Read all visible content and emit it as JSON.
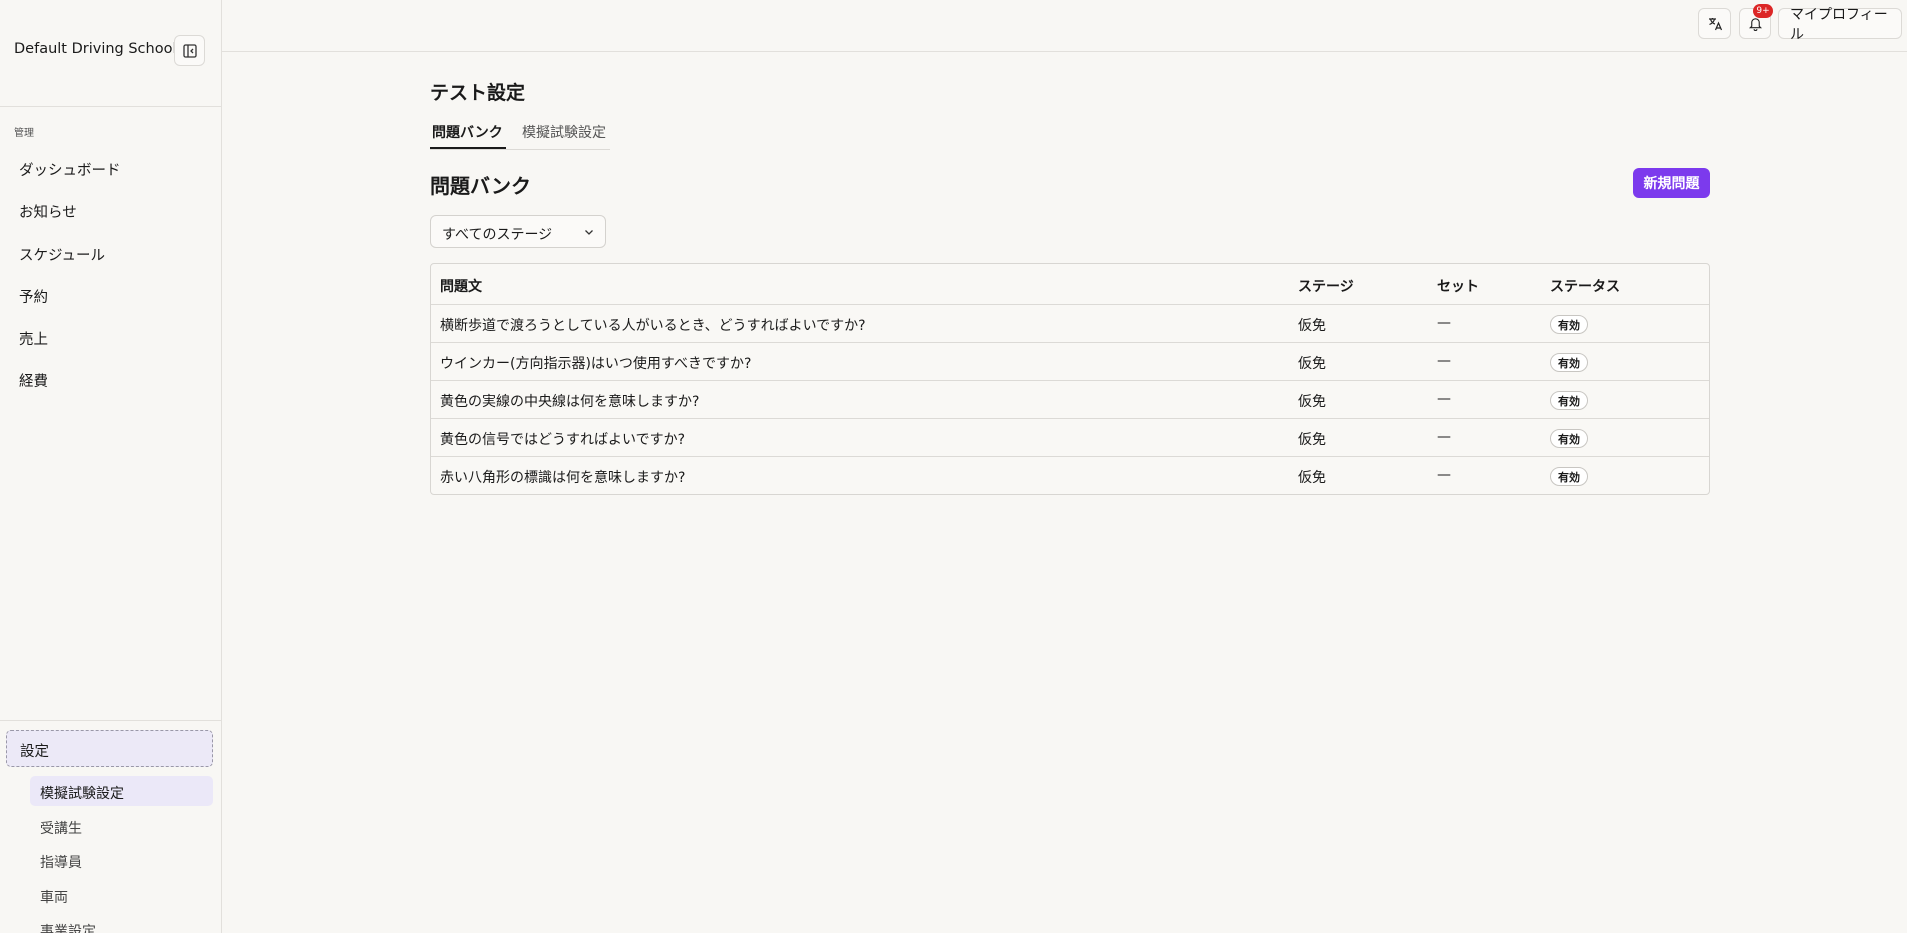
{
  "brand": {
    "name": "Default Driving School"
  },
  "sidebar": {
    "section_label": "管理",
    "items": [
      {
        "label": "ダッシュボード"
      },
      {
        "label": "お知らせ"
      },
      {
        "label": "スケジュール"
      },
      {
        "label": "予約"
      },
      {
        "label": "売上"
      },
      {
        "label": "経費"
      }
    ],
    "settings_label": "設定",
    "sub_items": [
      {
        "label": "模擬試験設定",
        "active": true
      },
      {
        "label": "受講生"
      },
      {
        "label": "指導員"
      },
      {
        "label": "車両"
      },
      {
        "label": "事業設定"
      }
    ]
  },
  "header": {
    "notification_badge": "9+",
    "profile_label": "マイプロフィール",
    "icons": [
      "translate-icon",
      "bell-icon"
    ]
  },
  "main": {
    "page_title": "テスト設定",
    "tabs": [
      {
        "label": "問題バンク",
        "active": true
      },
      {
        "label": "模擬試験設定"
      }
    ],
    "section_title": "問題バンク",
    "new_button_label": "新規問題",
    "stage_filter_value": "すべてのステージ",
    "table": {
      "columns": [
        "問題文",
        "ステージ",
        "セット",
        "ステータス"
      ],
      "rows": [
        {
          "question": "横断歩道で渡ろうとしている人がいるとき、どうすればよいですか?",
          "stage": "仮免",
          "set": "—",
          "status": "有効"
        },
        {
          "question": "ウインカー(方向指示器)はいつ使用すべきですか?",
          "stage": "仮免",
          "set": "—",
          "status": "有効"
        },
        {
          "question": "黄色の実線の中央線は何を意味しますか?",
          "stage": "仮免",
          "set": "—",
          "status": "有効"
        },
        {
          "question": "黄色の信号ではどうすればよいですか?",
          "stage": "仮免",
          "set": "—",
          "status": "有効"
        },
        {
          "question": "赤い八角形の標識は何を意味しますか?",
          "stage": "仮免",
          "set": "—",
          "status": "有効"
        }
      ]
    }
  },
  "colors": {
    "accent": "#7c3aed",
    "badge_red": "#dc2626",
    "background": "#f8f7f4"
  }
}
